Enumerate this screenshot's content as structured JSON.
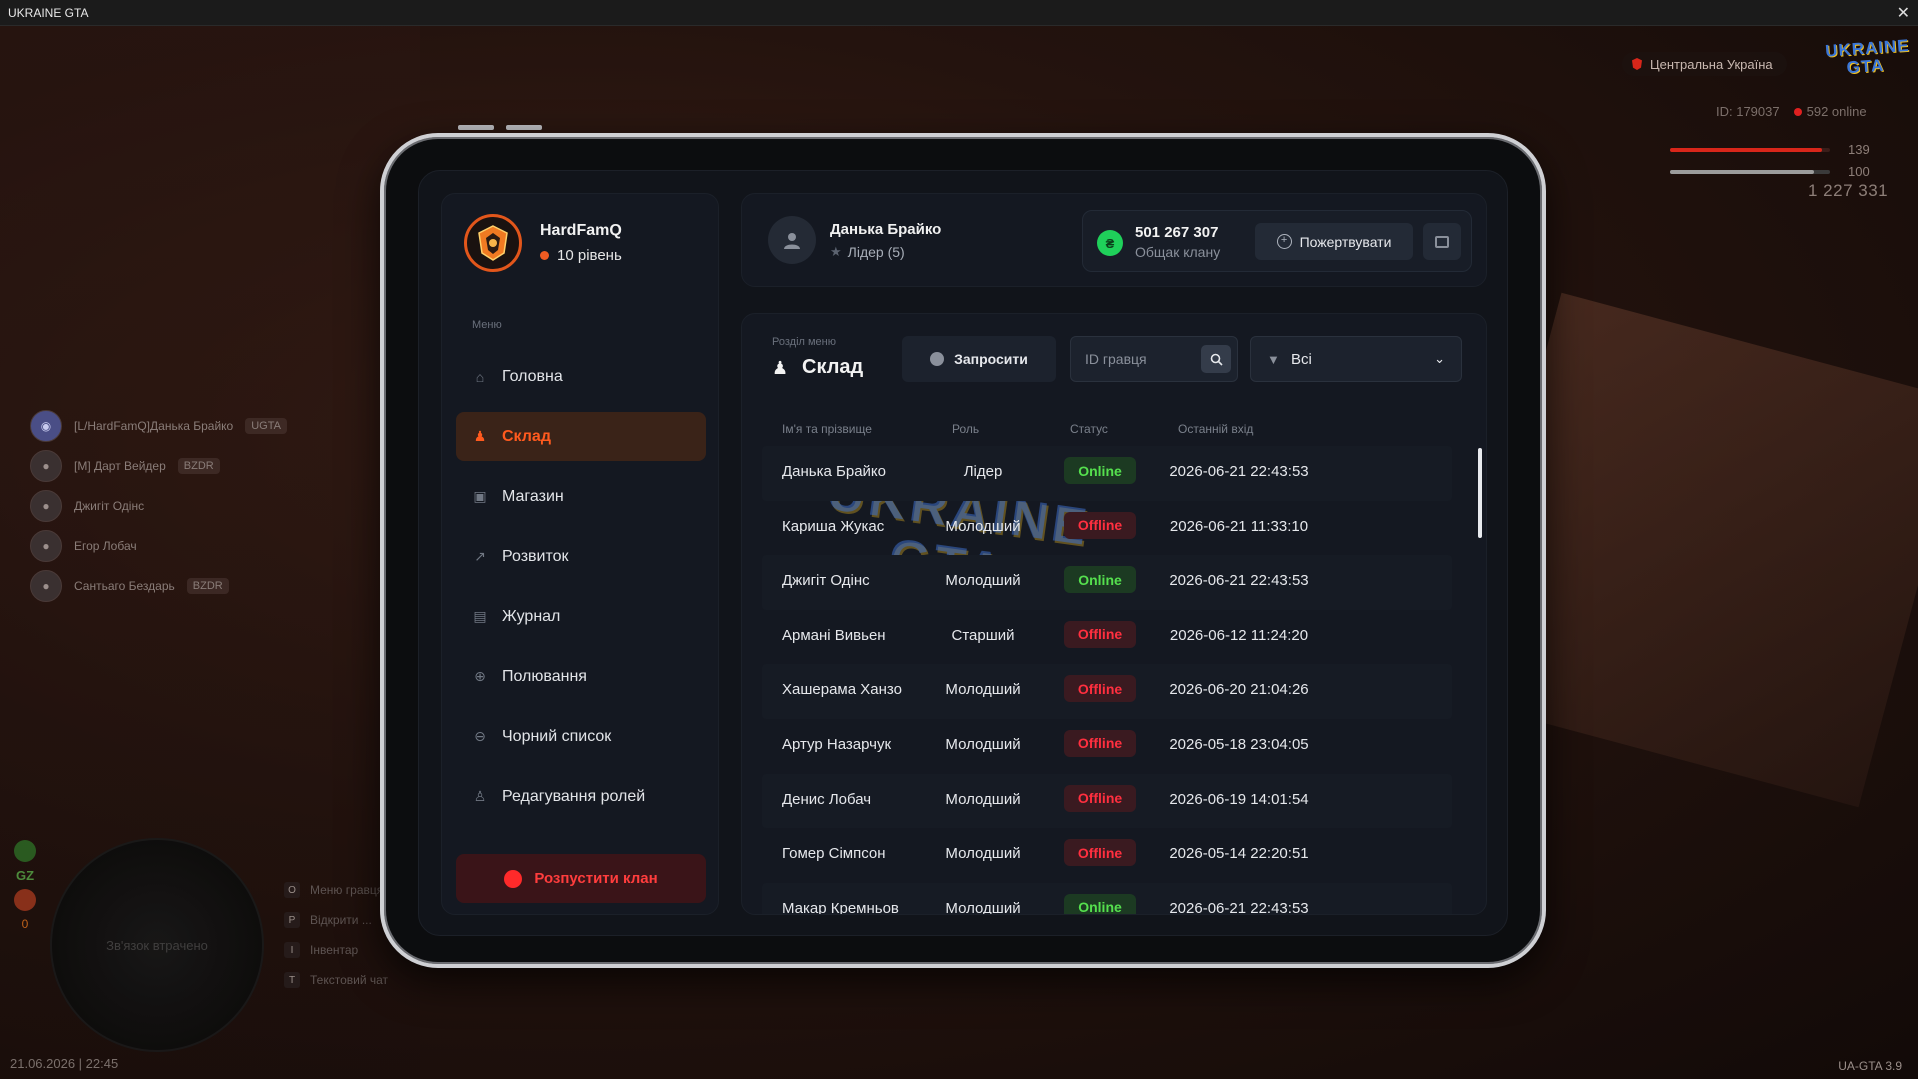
{
  "window": {
    "title": "UKRAINE GTA",
    "close": "✕"
  },
  "hud": {
    "region": "Центральна Україна",
    "logo_line1": "UKRAINE",
    "logo_line2": "GTA",
    "player_id": "ID: 179037",
    "online": "592 online",
    "health": "139",
    "armor": "100",
    "money": "1 227 331",
    "version": "UA-GTA 3.9",
    "datetime": "21.06.2026 | 22:45",
    "gz": "GZ",
    "zero": "0",
    "lost_connection": "Зв'язок втрачено",
    "accent_red": "#e02020",
    "health_fraction": 0.95,
    "armor_fraction": 0.9
  },
  "voice_chat": [
    {
      "name": "[L/HardFamQ]Данька Брайко",
      "tag": "UGTA",
      "avatar_icon": "discord-icon"
    },
    {
      "name": "[M] Дарт Вейдер",
      "tag": "BZDR",
      "avatar_icon": "avatar-icon"
    },
    {
      "name": "Джигіт Одінс",
      "tag": "",
      "avatar_icon": "avatar-icon"
    },
    {
      "name": "Егор Лобач",
      "tag": "",
      "avatar_icon": "avatar-icon"
    },
    {
      "name": "Сантьаго Бездарь",
      "tag": "BZDR",
      "avatar_icon": "avatar-icon"
    }
  ],
  "keybinds": [
    {
      "key": "O",
      "label": "Меню гравця"
    },
    {
      "key": "P",
      "label": "Відкрити ..."
    },
    {
      "key": "I",
      "label": "Інвентар"
    },
    {
      "key": "T",
      "label": "Текстовий чат"
    }
  ],
  "sidebar": {
    "clan_name": "HardFamQ",
    "level": "10 рівень",
    "menu_caption": "Меню",
    "items": [
      {
        "label": "Головна",
        "icon": "home-icon",
        "active": false
      },
      {
        "label": "Склад",
        "icon": "members-icon",
        "active": true
      },
      {
        "label": "Магазин",
        "icon": "shop-icon",
        "active": false
      },
      {
        "label": "Розвиток",
        "icon": "chart-icon",
        "active": false
      },
      {
        "label": "Журнал",
        "icon": "book-icon",
        "active": false
      },
      {
        "label": "Полювання",
        "icon": "target-icon",
        "active": false
      },
      {
        "label": "Чорний список",
        "icon": "block-icon",
        "active": false
      },
      {
        "label": "Редагування ролей",
        "icon": "role-icon",
        "active": false
      }
    ],
    "disband_label": "Розпустити клан"
  },
  "header": {
    "leader_name": "Данька Брайко",
    "leader_role": "Лідер (5)",
    "bank_amount": "501 267 307",
    "bank_label": "Общак клану",
    "donate_label": "Пожертвувати",
    "accent_green": "#1fd05a"
  },
  "section": {
    "caption": "Розділ меню",
    "title": "Склад",
    "invite_label": "Запросити",
    "search_placeholder": "ID гравця",
    "filter_value": "Всі"
  },
  "table": {
    "columns": [
      "Ім'я та прізвище",
      "Роль",
      "Статус",
      "Останній вхід"
    ],
    "rows": [
      {
        "name": "Данька Брайко",
        "role": "Лідер",
        "status": "Online",
        "last": "2026-06-21 22:43:53"
      },
      {
        "name": "Кариша Жукас",
        "role": "Молодший",
        "status": "Offline",
        "last": "2026-06-21 11:33:10"
      },
      {
        "name": "Джигіт Одінс",
        "role": "Молодший",
        "status": "Online",
        "last": "2026-06-21 22:43:53"
      },
      {
        "name": "Армані Вивьен",
        "role": "Старший",
        "status": "Offline",
        "last": "2026-06-12 11:24:20"
      },
      {
        "name": "Хашерама Ханзо",
        "role": "Молодший",
        "status": "Offline",
        "last": "2026-06-20 21:04:26"
      },
      {
        "name": "Артур Назарчук",
        "role": "Молодший",
        "status": "Offline",
        "last": "2026-05-18 23:04:05"
      },
      {
        "name": "Денис Лобач",
        "role": "Молодший",
        "status": "Offline",
        "last": "2026-06-19 14:01:54"
      },
      {
        "name": "Гомер Сімпсон",
        "role": "Молодший",
        "status": "Offline",
        "last": "2026-05-14 22:20:51"
      },
      {
        "name": "Макар Кремньов",
        "role": "Молодший",
        "status": "Online",
        "last": "2026-06-21 22:43:53"
      }
    ]
  },
  "watermark_line1": "UKRAINE",
  "watermark_line2": "GTA"
}
